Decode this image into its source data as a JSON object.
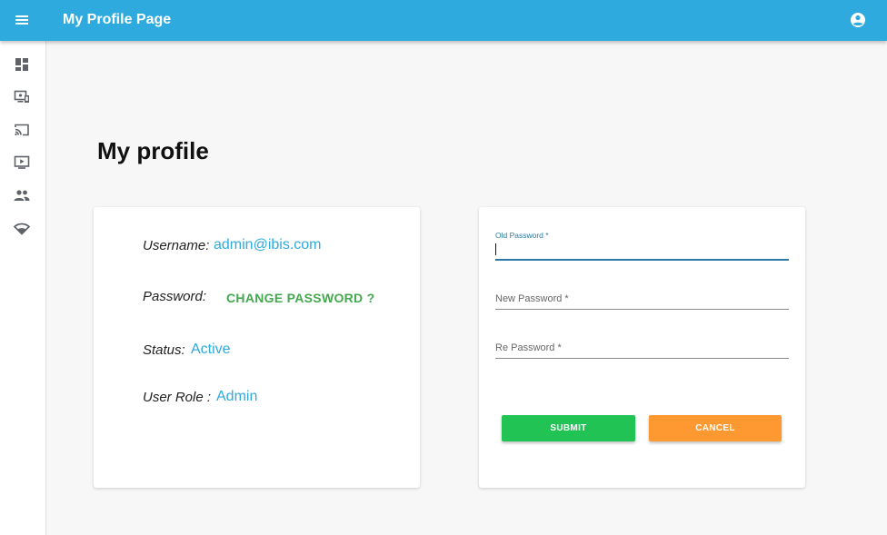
{
  "app": {
    "title": "My Profile Page"
  },
  "icons": {
    "menu": "menu-icon",
    "account": "account-circle-icon",
    "sidebar": [
      "dashboard-icon",
      "monitor-devices-icon",
      "cast-icon",
      "video-display-icon",
      "users-icon",
      "wifi-icon"
    ]
  },
  "page": {
    "heading": "My profile"
  },
  "profile": {
    "username_label": "Username:",
    "username_value": "admin@ibis.com",
    "password_label": "Password:",
    "change_password_link": "CHANGE PASSWORD ?",
    "status_label": "Status:",
    "status_value": "Active",
    "role_label": "User Role :",
    "role_value": "Admin"
  },
  "password_form": {
    "old_password_label": "Old Password *",
    "old_password_value": "",
    "new_password_label": "New Password *",
    "new_password_value": "",
    "re_password_label": "Re Password *",
    "re_password_value": "",
    "submit_label": "SUBMIT",
    "cancel_label": "CANCEL"
  },
  "colors": {
    "primary": "#2eaadf",
    "link_green": "#43a84e",
    "submit": "#21c454",
    "cancel": "#fe9831",
    "focus": "#2b7aa6"
  }
}
